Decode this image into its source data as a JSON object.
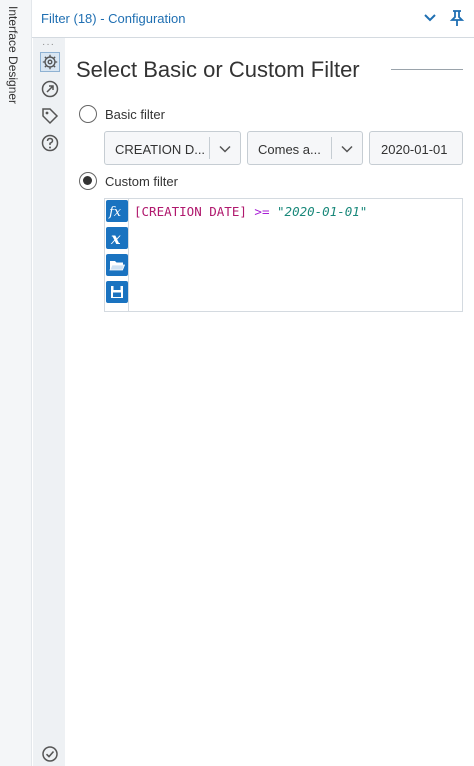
{
  "side_tab": {
    "label": "Interface Designer"
  },
  "header": {
    "title": "Filter (18) - Configuration"
  },
  "rail": {
    "dots": "···",
    "icons": [
      "gear-icon",
      "connection-icon",
      "tag-icon",
      "help-icon"
    ],
    "bottom_icon": "check-circle-icon"
  },
  "main": {
    "title": "Select Basic or Custom Filter",
    "basic": {
      "label": "Basic filter",
      "selected": false,
      "field": "CREATION D...",
      "operator": "Comes a...",
      "value": "2020-01-01"
    },
    "custom": {
      "label": "Custom filter",
      "selected": true,
      "expression": {
        "field": "[CREATION DATE]",
        "operator": ">=",
        "value": "\"2020-01-01\""
      },
      "tools": [
        "fx-icon",
        "variable-x-icon",
        "open-folder-icon",
        "save-icon"
      ]
    }
  },
  "colors": {
    "accent": "#1a73c0",
    "header_text": "#1f6fb2"
  }
}
